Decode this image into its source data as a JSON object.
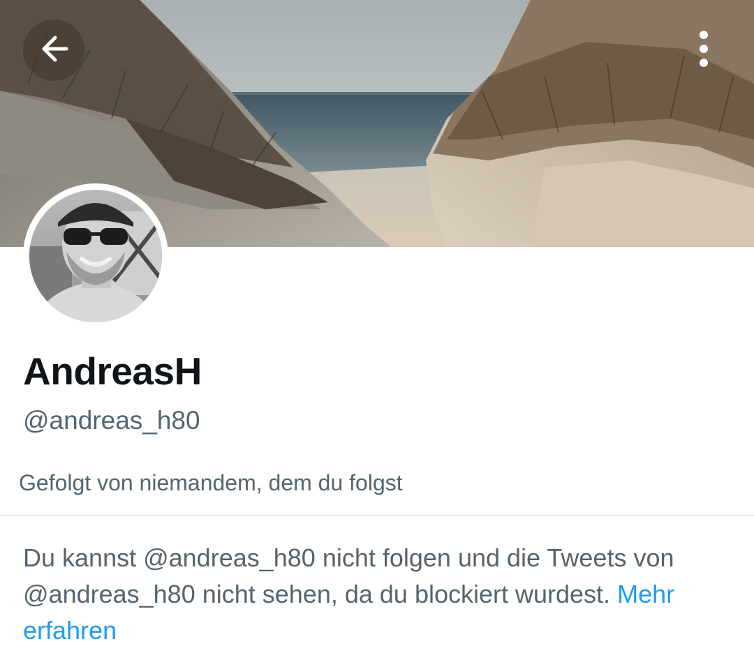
{
  "header": {
    "back_icon": "arrow-left-icon",
    "more_icon": "more-vertical-icon",
    "banner_description_colors": {
      "sky": "#c3c9ca",
      "sea": "#4f6571",
      "sand": "#cbbba8",
      "dune_grass": "#7d6a55"
    }
  },
  "profile": {
    "display_name": "AndreasH",
    "handle": "@andreas_h80",
    "followed_by": "Gefolgt von niemandem, dem du folgst"
  },
  "notice": {
    "text": "Du kannst @andreas_h80 nicht folgen und die Tweets von @andreas_h80 nicht sehen, da du blockiert wurdest.",
    "link_label": "Mehr erfahren"
  },
  "colors": {
    "primary_text": "#0f1419",
    "secondary_text": "#536471",
    "link": "#1d9bf0",
    "divider": "#cfd9de"
  }
}
